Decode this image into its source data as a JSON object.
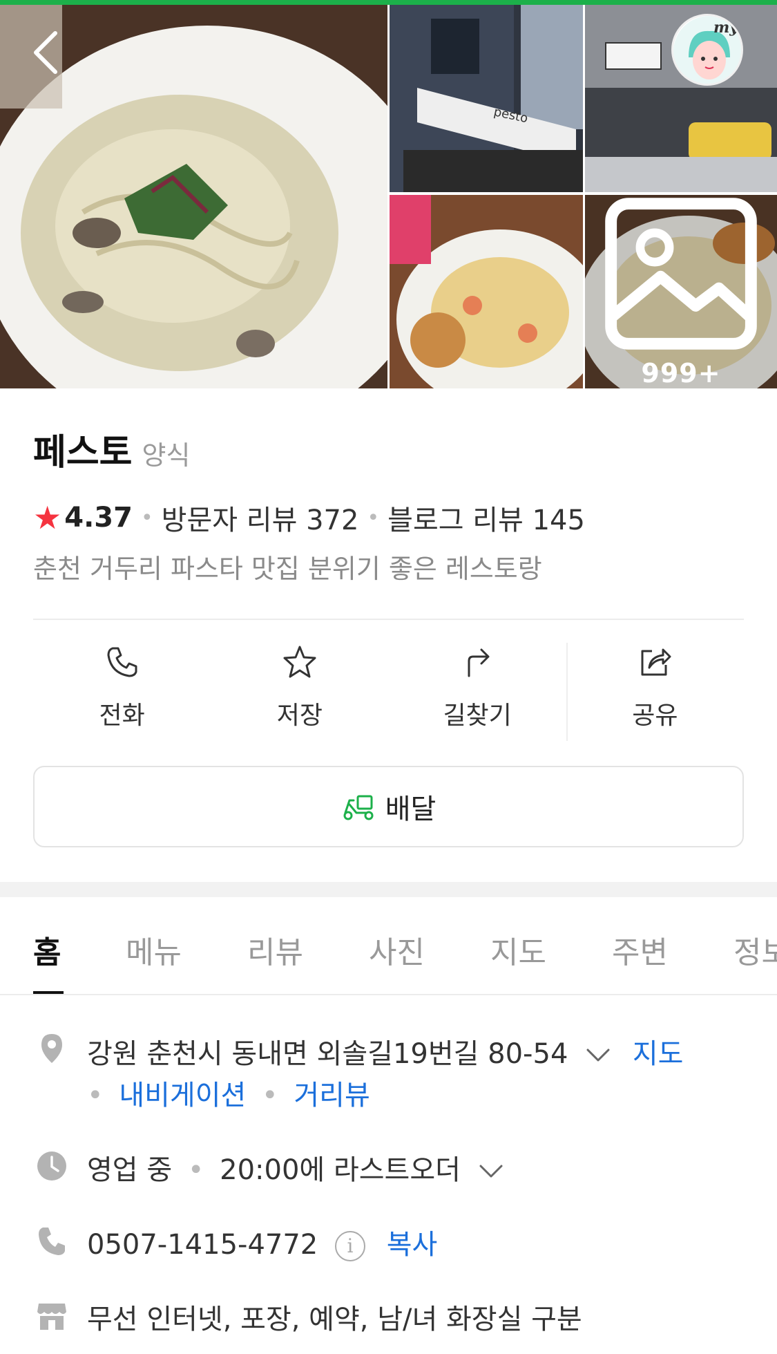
{
  "place": {
    "name": "페스토",
    "category": "양식",
    "rating": "4.37",
    "visitor_reviews": "방문자 리뷰 372",
    "blog_reviews": "블로그 리뷰 145",
    "description": "춘천 거두리 파스타 맛집 분위기 좋은 레스토랑"
  },
  "gallery": {
    "more_count": "999+",
    "avatar_text": "my",
    "sign_text": "pesto"
  },
  "actions": [
    {
      "label": "전화",
      "icon": "phone-icon"
    },
    {
      "label": "저장",
      "icon": "star-icon"
    },
    {
      "label": "길찾기",
      "icon": "directions-icon"
    },
    {
      "label": "공유",
      "icon": "share-icon"
    }
  ],
  "delivery": {
    "label": "배달",
    "icon": "delivery-scooter-icon"
  },
  "tabs": [
    {
      "label": "홈",
      "active": true
    },
    {
      "label": "메뉴"
    },
    {
      "label": "리뷰"
    },
    {
      "label": "사진"
    },
    {
      "label": "지도"
    },
    {
      "label": "주변"
    },
    {
      "label": "정보"
    }
  ],
  "info": {
    "address": "강원 춘천시 동내면 외솔길19번길 80-54",
    "address_links": {
      "map": "지도",
      "navigation": "내비게이션",
      "roadview": "거리뷰"
    },
    "hours_status": "영업 중",
    "hours_detail": "20:00에 라스트오더",
    "phone": "0507-1415-4772",
    "phone_copy": "복사",
    "amenities": "무선 인터넷, 포장, 예약, 남/녀 화장실 구분"
  },
  "colors": {
    "brand_green": "#1cb04a",
    "star_red": "#f5333f",
    "link_blue": "#1b6fdb"
  }
}
